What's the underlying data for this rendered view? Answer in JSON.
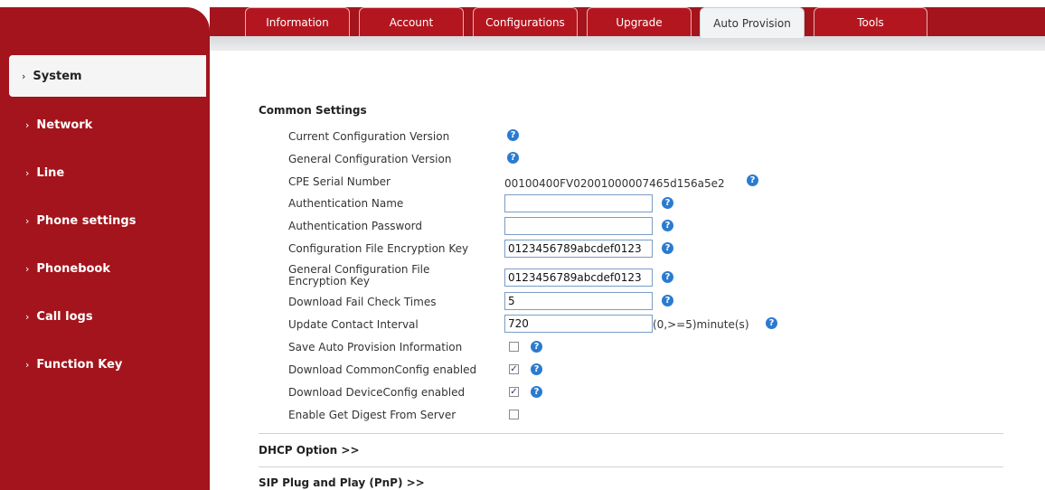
{
  "tabs": [
    {
      "label": "Information"
    },
    {
      "label": "Account"
    },
    {
      "label": "Configurations"
    },
    {
      "label": "Upgrade"
    },
    {
      "label": "Auto Provision"
    },
    {
      "label": "Tools"
    }
  ],
  "active_tab": "Auto Provision",
  "sidebar": {
    "items": [
      {
        "label": "System"
      },
      {
        "label": "Network"
      },
      {
        "label": "Line"
      },
      {
        "label": "Phone settings"
      },
      {
        "label": "Phonebook"
      },
      {
        "label": "Call logs"
      },
      {
        "label": "Function Key"
      }
    ],
    "active": "System",
    "chevron": "›"
  },
  "common": {
    "title": "Common Settings",
    "current_config_version": "Current Configuration Version",
    "general_config_version": "General Configuration Version",
    "cpe_serial_label": "CPE Serial Number",
    "cpe_serial_value": "00100400FV02001000007465d156a5e2",
    "auth_name_label": "Authentication Name",
    "auth_name_value": "",
    "auth_password_label": "Authentication Password",
    "auth_password_value": "",
    "config_key_label": "Configuration File Encryption Key",
    "config_key_value": "0123456789abcdef0123",
    "general_key_label_1": "General Configuration File",
    "general_key_label_2": "Encryption Key",
    "general_key_value": "0123456789abcdef0123",
    "fail_check_label": "Download Fail Check Times",
    "fail_check_value": "5",
    "update_interval_label": "Update Contact Interval",
    "update_interval_value": "720",
    "update_interval_unit": "(0,>=5)minute(s)",
    "save_info_label": "Save Auto Provision Information",
    "save_info_checked": false,
    "common_config_label": "Download CommonConfig enabled",
    "common_config_checked": true,
    "device_config_label": "Download DeviceConfig enabled",
    "device_config_checked": true,
    "digest_label": "Enable Get Digest From Server",
    "digest_checked": false
  },
  "dhcp_option": "DHCP Option >>",
  "sip_pnp": "SIP Plug and Play (PnP) >>",
  "help_glyph": "?",
  "check_glyph": "✓",
  "colors": {
    "brand_red": "#a3141c",
    "help_blue": "#2a7bd0"
  }
}
